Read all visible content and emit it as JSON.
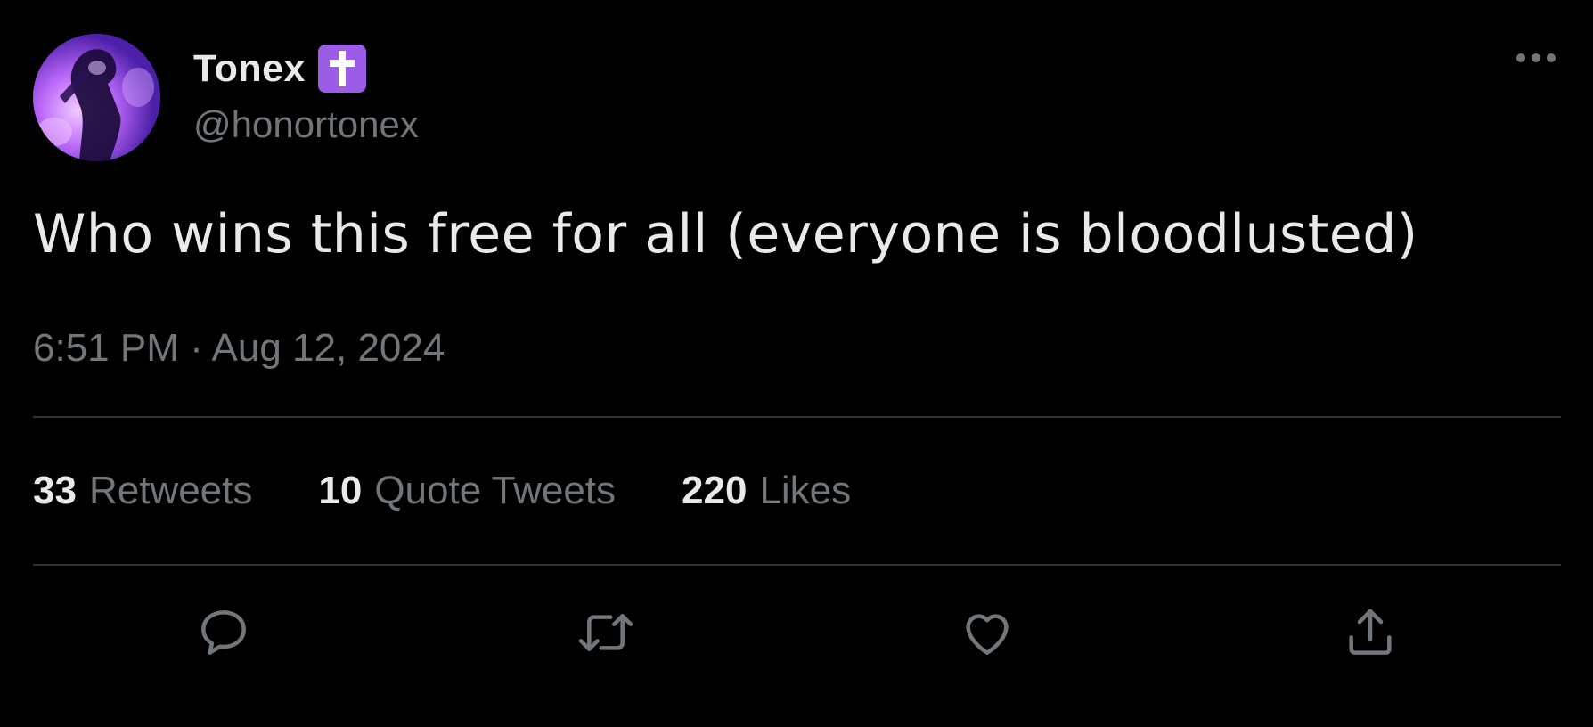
{
  "author": {
    "display_name": "Tonex",
    "badge_icon": "latin-cross-icon",
    "badge_color": "#9b5de5",
    "handle": "@honortonex"
  },
  "tweet": {
    "text": "Who wins this free for all (everyone is bloodlusted)",
    "timestamp": "6:51 PM · Aug 12, 2024"
  },
  "stats": {
    "retweets": {
      "count": "33",
      "label": "Retweets"
    },
    "quotes": {
      "count": "10",
      "label": "Quote Tweets"
    },
    "likes": {
      "count": "220",
      "label": "Likes"
    }
  },
  "actions": [
    {
      "name": "reply",
      "icon": "reply-icon"
    },
    {
      "name": "retweet",
      "icon": "retweet-icon"
    },
    {
      "name": "like",
      "icon": "heart-icon"
    },
    {
      "name": "share",
      "icon": "share-icon"
    }
  ],
  "theme": {
    "background": "#000000",
    "text_primary": "#e7e9ea",
    "text_secondary": "#71767b",
    "divider": "#2f3336"
  }
}
